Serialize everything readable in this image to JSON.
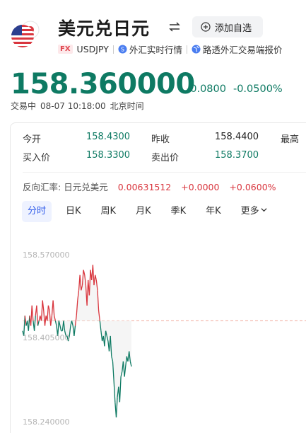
{
  "header": {
    "title": "美元兑日元",
    "add_button": "添加自选",
    "badge": "FX",
    "code": "USDJPY",
    "source1": "外汇实时行情",
    "source2": "路透外汇交易端报价"
  },
  "quote": {
    "price": "158.360000",
    "change": "-0.0800",
    "change_pct": "-0.0500%",
    "status": "交易中",
    "datetime": "08-07 10:18:00",
    "timezone": "北京时间"
  },
  "stats": {
    "open_label": "今开",
    "open_value": "158.4300",
    "prev_label": "昨收",
    "prev_value": "158.4400",
    "high_label": "最高",
    "bid_label": "买入价",
    "bid_value": "158.3300",
    "ask_label": "卖出价",
    "ask_value": "158.3700"
  },
  "reverse": {
    "label": "反向汇率:",
    "pair": "日元兑美元",
    "value": "0.00631512",
    "change": "+0.0000",
    "change_pct": "+0.0600%"
  },
  "tabs": [
    "分时",
    "日K",
    "周K",
    "月K",
    "季K",
    "年K",
    "更多"
  ],
  "colors": {
    "up": "#d9363e",
    "down": "#0e7a63",
    "accent": "#2f5bea"
  },
  "chart_data": {
    "type": "line",
    "y_ticks": [
      "158.570000",
      "158.405000",
      "158.240000"
    ],
    "ylim": [
      158.24,
      158.57
    ],
    "reference_line": 158.44,
    "values": [
      158.42,
      158.41,
      158.45,
      158.43,
      158.44,
      158.42,
      158.45,
      158.43,
      158.47,
      158.44,
      158.42,
      158.45,
      158.47,
      158.43,
      158.44,
      158.45,
      158.44,
      158.48,
      158.46,
      158.43,
      158.45,
      158.44,
      158.47,
      158.46,
      158.43,
      158.45,
      158.48,
      158.45,
      158.44,
      158.43,
      158.41,
      158.44,
      158.43,
      158.42,
      158.42,
      158.44,
      158.42,
      158.41,
      158.41,
      158.4,
      158.41,
      158.43,
      158.44,
      158.43,
      158.41,
      158.43,
      158.45,
      158.48,
      158.5,
      158.53,
      158.5,
      158.51,
      158.54,
      158.53,
      158.51,
      158.47,
      158.52,
      158.49,
      158.54,
      158.52,
      158.55,
      158.51,
      158.53,
      158.52,
      158.5,
      158.46,
      158.44,
      158.42,
      158.4,
      158.41,
      158.39,
      158.42,
      158.41,
      158.4,
      158.38,
      158.41,
      158.37,
      158.36,
      158.32,
      158.28,
      158.25,
      158.29,
      158.31,
      158.28,
      158.33,
      158.34,
      158.36,
      158.33,
      158.35,
      158.37,
      158.36,
      158.38,
      158.36,
      158.35
    ]
  }
}
